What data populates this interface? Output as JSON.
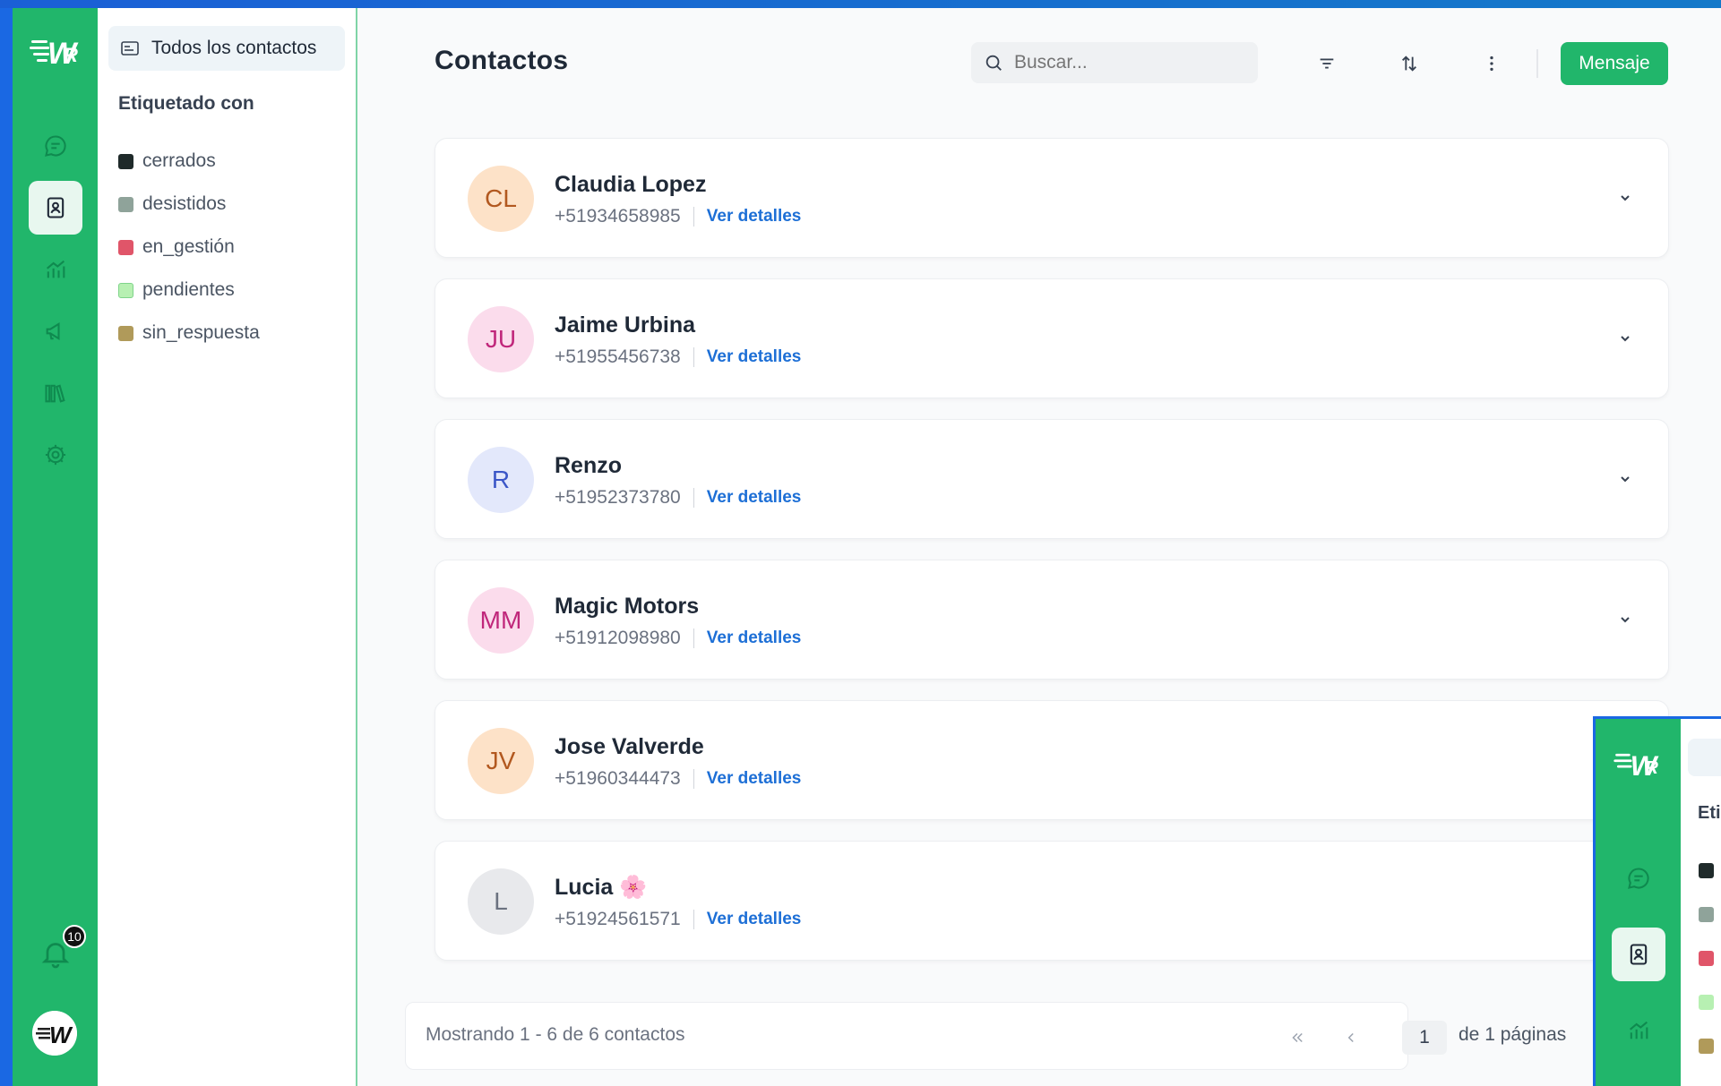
{
  "sidebar": {
    "all_contacts_label": "Todos los contactos",
    "section_title": "Etiquetado con",
    "tags": [
      {
        "label": "cerrados",
        "color": "#1f2a2a"
      },
      {
        "label": "desistidos",
        "color": "#8fa39a"
      },
      {
        "label": "en_gestión",
        "color": "#e05569"
      },
      {
        "label": "pendientes",
        "color": "#b7f0b2"
      },
      {
        "label": "sin_respuesta",
        "color": "#b09a5a"
      }
    ]
  },
  "rail": {
    "notification_count": "10",
    "accent": "#21b66b"
  },
  "header": {
    "title": "Contactos",
    "search_placeholder": "Buscar...",
    "message_button": "Mensaje"
  },
  "contacts": [
    {
      "initials": "CL",
      "name": "Claudia Lopez",
      "phone": "+51934658985",
      "link": "Ver detalles",
      "bg": "#fde2c8",
      "fg": "#b2581f"
    },
    {
      "initials": "JU",
      "name": "Jaime Urbina",
      "phone": "+51955456738",
      "link": "Ver detalles",
      "bg": "#fbdcec",
      "fg": "#c0277b"
    },
    {
      "initials": "R",
      "name": "Renzo",
      "phone": "+51952373780",
      "link": "Ver detalles",
      "bg": "#e3e8fb",
      "fg": "#3b56c7"
    },
    {
      "initials": "MM",
      "name": "Magic Motors",
      "phone": "+51912098980",
      "link": "Ver detalles",
      "bg": "#fbdcec",
      "fg": "#c0277b"
    },
    {
      "initials": "JV",
      "name": "Jose Valverde",
      "phone": "+51960344473",
      "link": "Ver detalles",
      "bg": "#fde2c8",
      "fg": "#b2581f"
    },
    {
      "initials": "L",
      "name": "Lucia 🌸",
      "phone": "+51924561571",
      "link": "Ver detalles",
      "bg": "#e8e9ec",
      "fg": "#6b7280"
    }
  ],
  "footer": {
    "count_text": "Mostrando 1 - 6 de 6 contactos",
    "page": "1",
    "of_pages": "de 1 páginas"
  }
}
